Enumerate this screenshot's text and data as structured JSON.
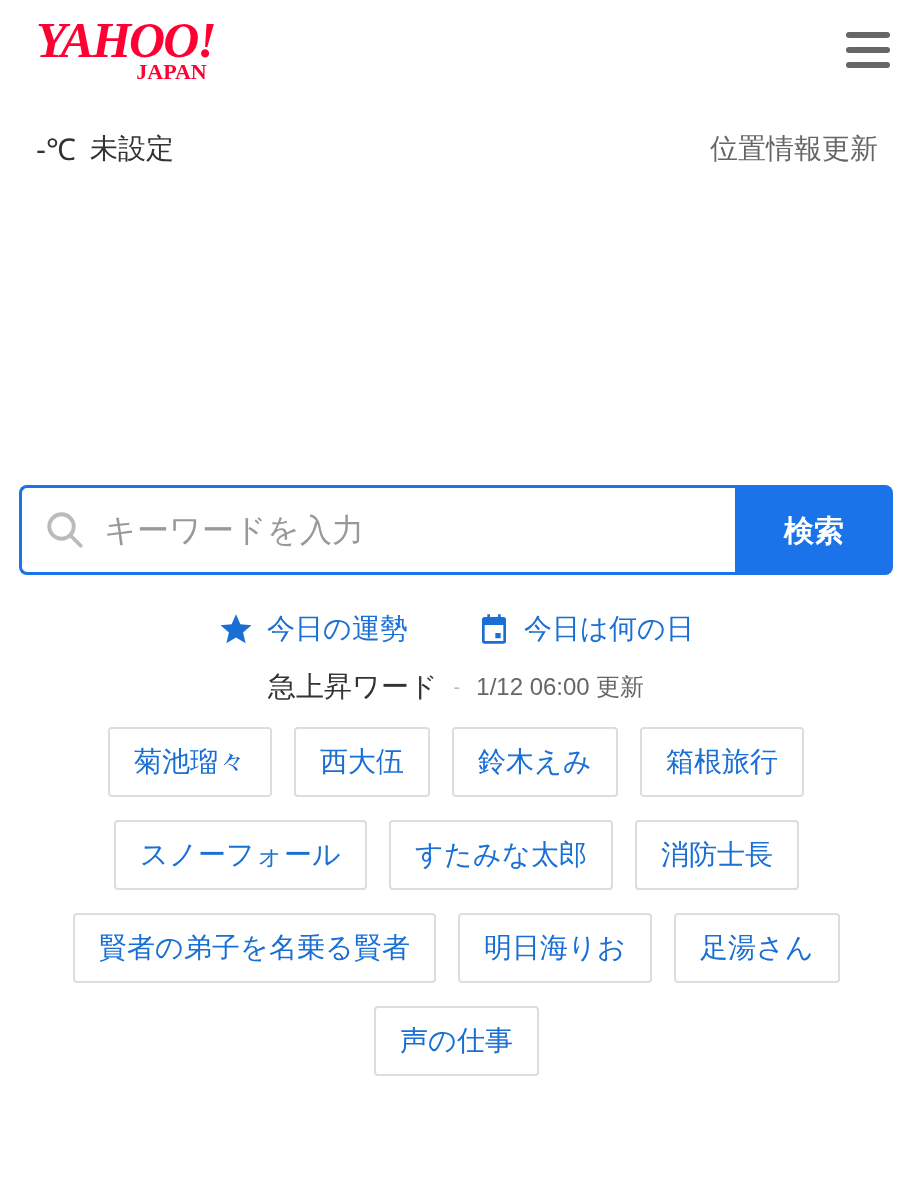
{
  "header": {
    "logo": {
      "main": "YAHOO!",
      "sub": "JAPAN"
    }
  },
  "weather": {
    "temperature": "-℃",
    "location": "未設定",
    "update_link": "位置情報更新"
  },
  "search": {
    "placeholder": "キーワードを入力",
    "button": "検索"
  },
  "quick_links": [
    {
      "kind": "star",
      "label": "今日の運勢"
    },
    {
      "kind": "calendar",
      "label": "今日は何の日"
    }
  ],
  "trending": {
    "title": "急上昇ワード",
    "separator": "-",
    "updated": "1/12 06:00 更新",
    "tags": [
      "菊池瑠々",
      "西大伍",
      "鈴木えみ",
      "箱根旅行",
      "スノーフォール",
      "すたみな太郎",
      "消防士長",
      "賢者の弟子を名乗る賢者",
      "明日海りお",
      "足湯さん",
      "声の仕事"
    ]
  }
}
